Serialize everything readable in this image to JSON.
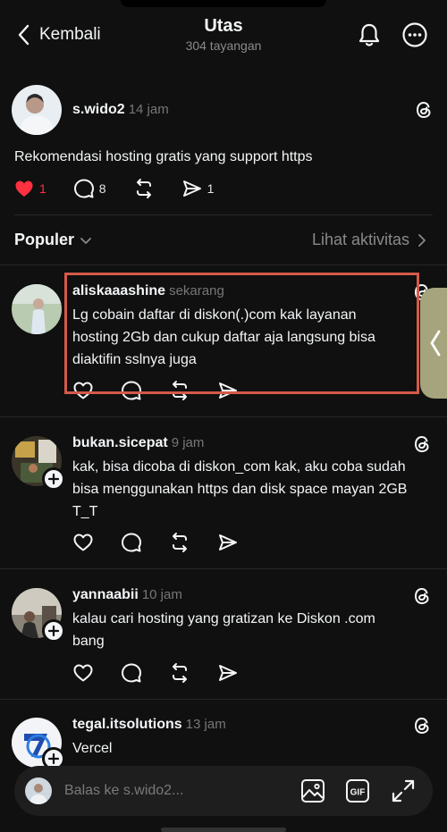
{
  "header": {
    "back_label": "Kembali",
    "title": "Utas",
    "views": "304 tayangan"
  },
  "main_post": {
    "username": "s.wido2",
    "time": "14 jam",
    "text": "Rekomendasi hosting gratis  yang support https",
    "likes": "1",
    "comments": "8",
    "shares": "1"
  },
  "sort": {
    "label": "Populer",
    "activity_link": "Lihat aktivitas"
  },
  "replies": [
    {
      "username": "aliskaaashine",
      "time": "sekarang",
      "lines": [
        "Lg cobain daftar di diskon(.)com kak layanan",
        "hosting 2Gb dan cukup daftar aja langsung bisa",
        "diaktifin sslnya juga"
      ]
    },
    {
      "username": "bukan.sicepat",
      "time": "9 jam",
      "lines": [
        "kak, bisa dicoba di diskon_com kak, aku coba sudah",
        "bisa menggunakan https dan disk space mayan 2GB",
        "T_T"
      ]
    },
    {
      "username": "yannaabii",
      "time": "10 jam",
      "lines": [
        "kalau cari hosting yang gratizan ke Diskon .com",
        "bang"
      ]
    },
    {
      "username": "tegal.itsolutions",
      "time": "13 jam",
      "lines": [
        "Vercel"
      ]
    }
  ],
  "reply_bar": {
    "placeholder": "Balas ke s.wido2..."
  },
  "colors": {
    "background": "#101010",
    "heart": "#ff3040",
    "highlight": "#d45a4a"
  },
  "icons": [
    "chevron-left-icon",
    "bell-icon",
    "more-icon",
    "threads-icon",
    "heart-icon",
    "comment-icon",
    "repost-icon",
    "send-icon",
    "chevron-down-icon",
    "chevron-right-icon",
    "plus-icon",
    "image-icon",
    "gif-icon",
    "expand-icon"
  ]
}
